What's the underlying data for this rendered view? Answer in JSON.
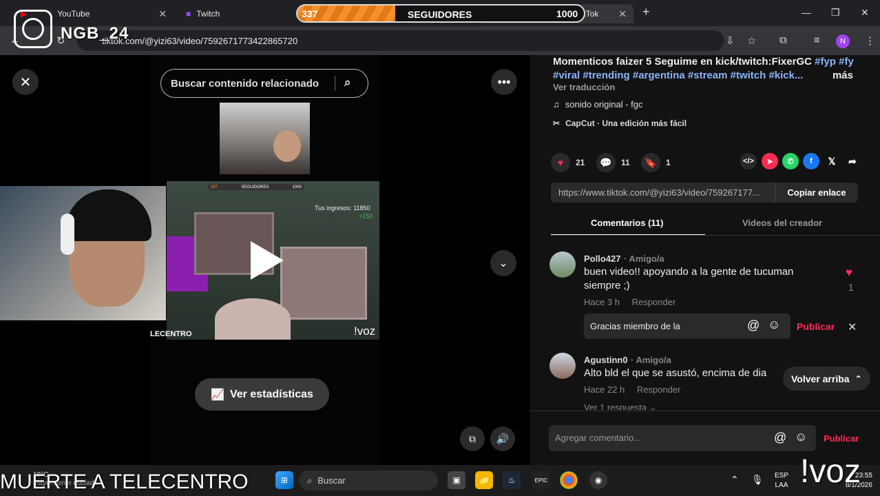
{
  "browser": {
    "tabs": [
      {
        "title": "YouTube"
      },
      {
        "title": "Twitch"
      },
      {
        "title": "(99+)fgc (@yizi63) | TikTok"
      }
    ],
    "partial_tab_text": "k D",
    "url": "tiktok.com/@yizi63/video/7592671773422865720",
    "profile_initial": "N"
  },
  "stream_overlay": {
    "logo_text": "NGB_24",
    "counter_current": "337",
    "counter_label": "SEGUIDORES",
    "counter_goal": "1000",
    "bottom_banner": "MUERTE A TELECENTRO",
    "voice_tag": "!voz"
  },
  "video": {
    "search_placeholder": "Buscar contenido relacionado",
    "in_video_text": "!voz",
    "in_video_banner": "LECENTRO",
    "in_game_income_label": "Tus ingresos: 11850",
    "in_game_income_delta": "+150",
    "mini_bar_left": "337",
    "mini_bar_mid": "SEGUIDORES",
    "mini_bar_right": "1000",
    "stats_button": "Ver estadísticas"
  },
  "description": {
    "text": "Momenticos faizer 5  Seguime en kick/twitch:FixerGC",
    "hashtags_line1": "#fyp #fy",
    "hashtags_line2": "#viral #trending #argentina #stream #twitch #kick...",
    "more": "más",
    "translate": "Ver traducción",
    "sound": "sonido original - fgc",
    "capcut": "CapCut · Una edición más fácil"
  },
  "stats": {
    "likes": "21",
    "comments": "11",
    "saves": "1"
  },
  "share": {
    "link": "https://www.tiktok.com/@yizi63/video/759267177...",
    "copy_button": "Copiar enlace"
  },
  "tabs": {
    "comments": "Comentarios (11)",
    "creator_videos": "Videos del creador"
  },
  "comments": [
    {
      "user": "Pollo427",
      "tag": "· Amigo/a",
      "text_line1": "buen video!! apoyando a la gente de tucuman",
      "text_line2": "siempre ;)",
      "time": "Hace 3 h",
      "reply": "Responder",
      "likes": "1"
    },
    {
      "user": "Agustinn0",
      "tag": "· Amigo/a",
      "text_line1": "Alto bld el que se asustó, encima de dia",
      "time": "Hace 22 h",
      "reply": "Responder",
      "view_replies": "Ver 1 respuesta"
    }
  ],
  "reply_box": {
    "value": "Gracias miembro de la ",
    "publish": "Publicar"
  },
  "back_to_top": "Volver arriba",
  "comment_input": {
    "placeholder": "Agregar comentario...",
    "publish": "Publicar"
  },
  "taskbar": {
    "weather_temp": "19°C",
    "weather_desc": "Mayormente nublado",
    "search": "Buscar",
    "lang_1": "ESP",
    "lang_2": "LAA",
    "time": "23:55",
    "date": "8/1/2026"
  },
  "colors": {
    "accent_pink": "#fe2c55",
    "hashtag_blue": "#8ab4f8",
    "overlay_orange": "#f5902b"
  }
}
